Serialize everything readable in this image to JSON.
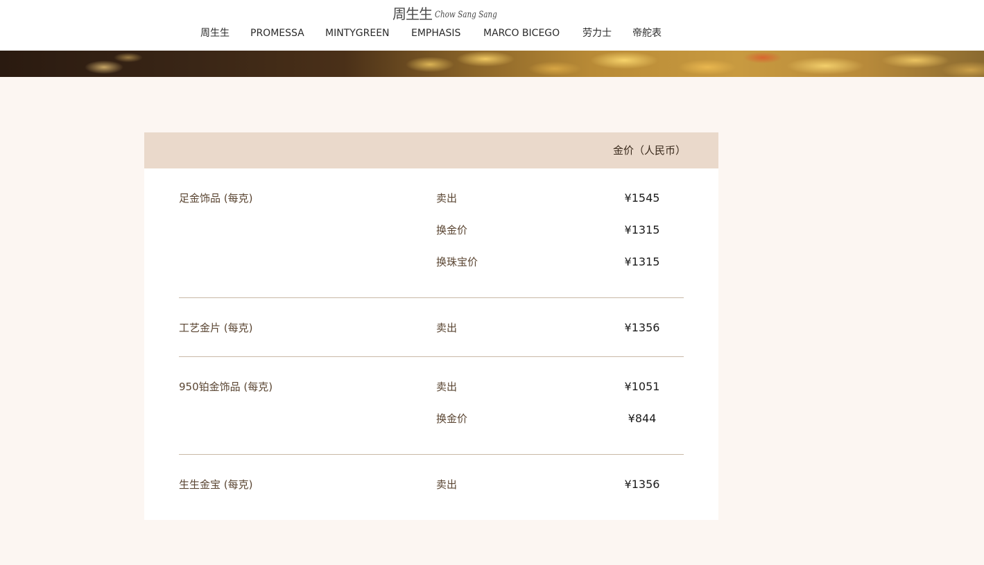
{
  "logo": {
    "cn": "周生生",
    "en": "Chow Sang Sang"
  },
  "nav": {
    "items": [
      {
        "label": "周生生"
      },
      {
        "label": "PROMESSA"
      },
      {
        "label": "MINTYGREEN"
      },
      {
        "label": "EMPHASIS"
      },
      {
        "label": "MARCO BICEGO"
      },
      {
        "label": "劳力士"
      },
      {
        "label": "帝舵表"
      }
    ]
  },
  "price_table": {
    "header_label": "金价（人民币）",
    "groups": [
      {
        "name": "足金饰品 (每克)",
        "rows": [
          {
            "label": "卖出",
            "price": "¥1545"
          },
          {
            "label": "换金价",
            "price": "¥1315"
          },
          {
            "label": "换珠宝价",
            "price": "¥1315"
          }
        ]
      },
      {
        "name": "工艺金片 (每克)",
        "rows": [
          {
            "label": "卖出",
            "price": "¥1356"
          }
        ]
      },
      {
        "name": "950铂金饰品 (每克)",
        "rows": [
          {
            "label": "卖出",
            "price": "¥1051"
          },
          {
            "label": "换金价",
            "price": "¥844"
          }
        ]
      },
      {
        "name": "生生金宝 (每克)",
        "rows": [
          {
            "label": "卖出",
            "price": "¥1356"
          }
        ]
      }
    ]
  }
}
